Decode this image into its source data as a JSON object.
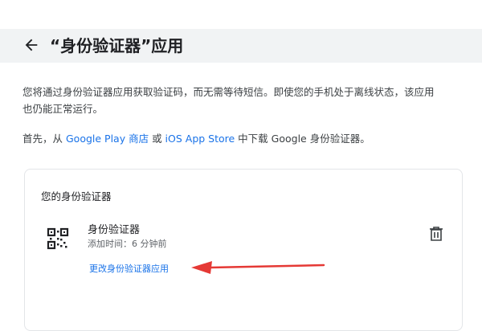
{
  "header": {
    "back_icon": "arrow-back-icon",
    "title": "“身份验证器”应用"
  },
  "description": {
    "line1": "您将通过身份验证器应用获取验证码，而无需等待短信。即使您的手机处于离线状态，该应用也仍能正常运行。",
    "line2_prefix": "首先，从 ",
    "google_play_link": "Google Play 商店",
    "or_text": " 或 ",
    "app_store_link": "iOS App Store",
    "line2_suffix": " 中下载 Google 身份验证器。"
  },
  "card": {
    "title": "您的身份验证器",
    "authenticator": {
      "icon": "qr-code-icon",
      "name": "身份验证器",
      "added_time": "添加时间：6 分钟前",
      "change_link": "更改身份验证器应用",
      "delete_icon": "trash-icon"
    }
  },
  "colors": {
    "header_bg": "#f1f3f4",
    "link": "#1a73e8",
    "annotation_arrow": "#e53935"
  }
}
